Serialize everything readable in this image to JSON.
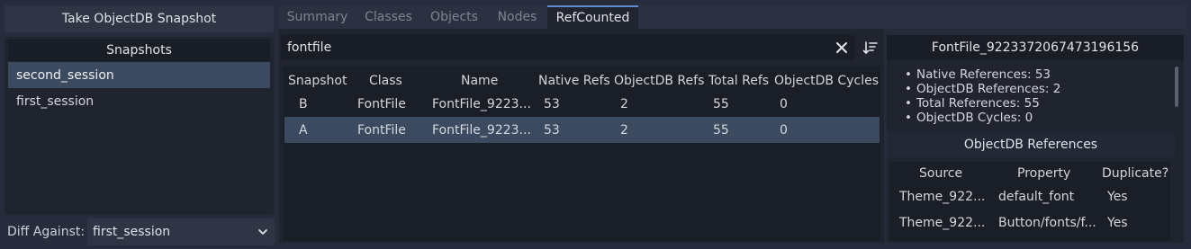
{
  "left": {
    "take_snapshot_label": "Take ObjectDB Snapshot",
    "snapshots_header": "Snapshots",
    "snapshots": [
      {
        "label": "second_session",
        "selected": true
      },
      {
        "label": "first_session",
        "selected": false
      }
    ],
    "diff_label": "Diff Against:",
    "diff_value": "first_session"
  },
  "tabs": [
    {
      "label": "Summary",
      "active": false
    },
    {
      "label": "Classes",
      "active": false
    },
    {
      "label": "Objects",
      "active": false
    },
    {
      "label": "Nodes",
      "active": false
    },
    {
      "label": "RefCounted",
      "active": true
    }
  ],
  "search": {
    "value": "fontfile"
  },
  "table": {
    "columns": [
      "Snapshot",
      "Class",
      "Name",
      "Native Refs",
      "ObjectDB Refs",
      "Total Refs",
      "ObjectDB Cycles"
    ],
    "rows": [
      {
        "snapshot": "B",
        "class": "FontFile",
        "name": "FontFile_9223...",
        "native_refs": "53",
        "objectdb_refs": "2",
        "total_refs": "55",
        "cycles": "0",
        "selected": false
      },
      {
        "snapshot": "A",
        "class": "FontFile",
        "name": "FontFile_9223...",
        "native_refs": "53",
        "objectdb_refs": "2",
        "total_refs": "55",
        "cycles": "0",
        "selected": true
      }
    ]
  },
  "detail": {
    "title": "FontFile_9223372067473196156",
    "stats": [
      "Native References: 53",
      "ObjectDB References: 2",
      "Total References: 55",
      "ObjectDB Cycles: 0"
    ],
    "refs_header": "ObjectDB References",
    "refs_columns": [
      "Source",
      "Property",
      "Duplicate?"
    ],
    "refs_rows": [
      {
        "source": "Theme_922...",
        "property": "default_font",
        "duplicate": "Yes"
      },
      {
        "source": "Theme_922...",
        "property": "Button/fonts/f...",
        "duplicate": "Yes"
      }
    ]
  },
  "colors": {
    "background": "#262c3b",
    "panel": "#20242f",
    "selection": "#3b4a5f",
    "accent": "#5d8fcf"
  },
  "icons": {
    "clear": "close-icon",
    "sort": "sort-icon",
    "dropdown": "chevron-down-icon"
  }
}
